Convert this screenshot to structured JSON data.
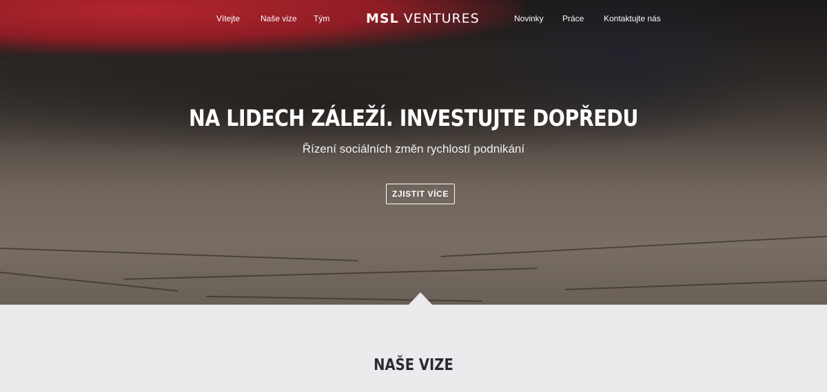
{
  "nav": {
    "left": [
      "Vítejte",
      "Naše vize",
      "Tým"
    ],
    "right": [
      "Novinky",
      "Práce",
      "Kontaktujte nás"
    ]
  },
  "brand": {
    "strong": "MSL",
    "light": "VENTURES"
  },
  "hero": {
    "title": "NA LIDECH ZÁLEŽÍ. INVESTUJTE DOPŘEDU",
    "subtitle": "Řízení sociálních změn rychlostí podnikání",
    "cta": "ZJISTIT VÍCE"
  },
  "section": {
    "title": "NAŠE VIZE"
  },
  "colors": {
    "section_bg": "#ebebee",
    "section_title": "#2a2a33",
    "hero_text": "#ffffff"
  }
}
